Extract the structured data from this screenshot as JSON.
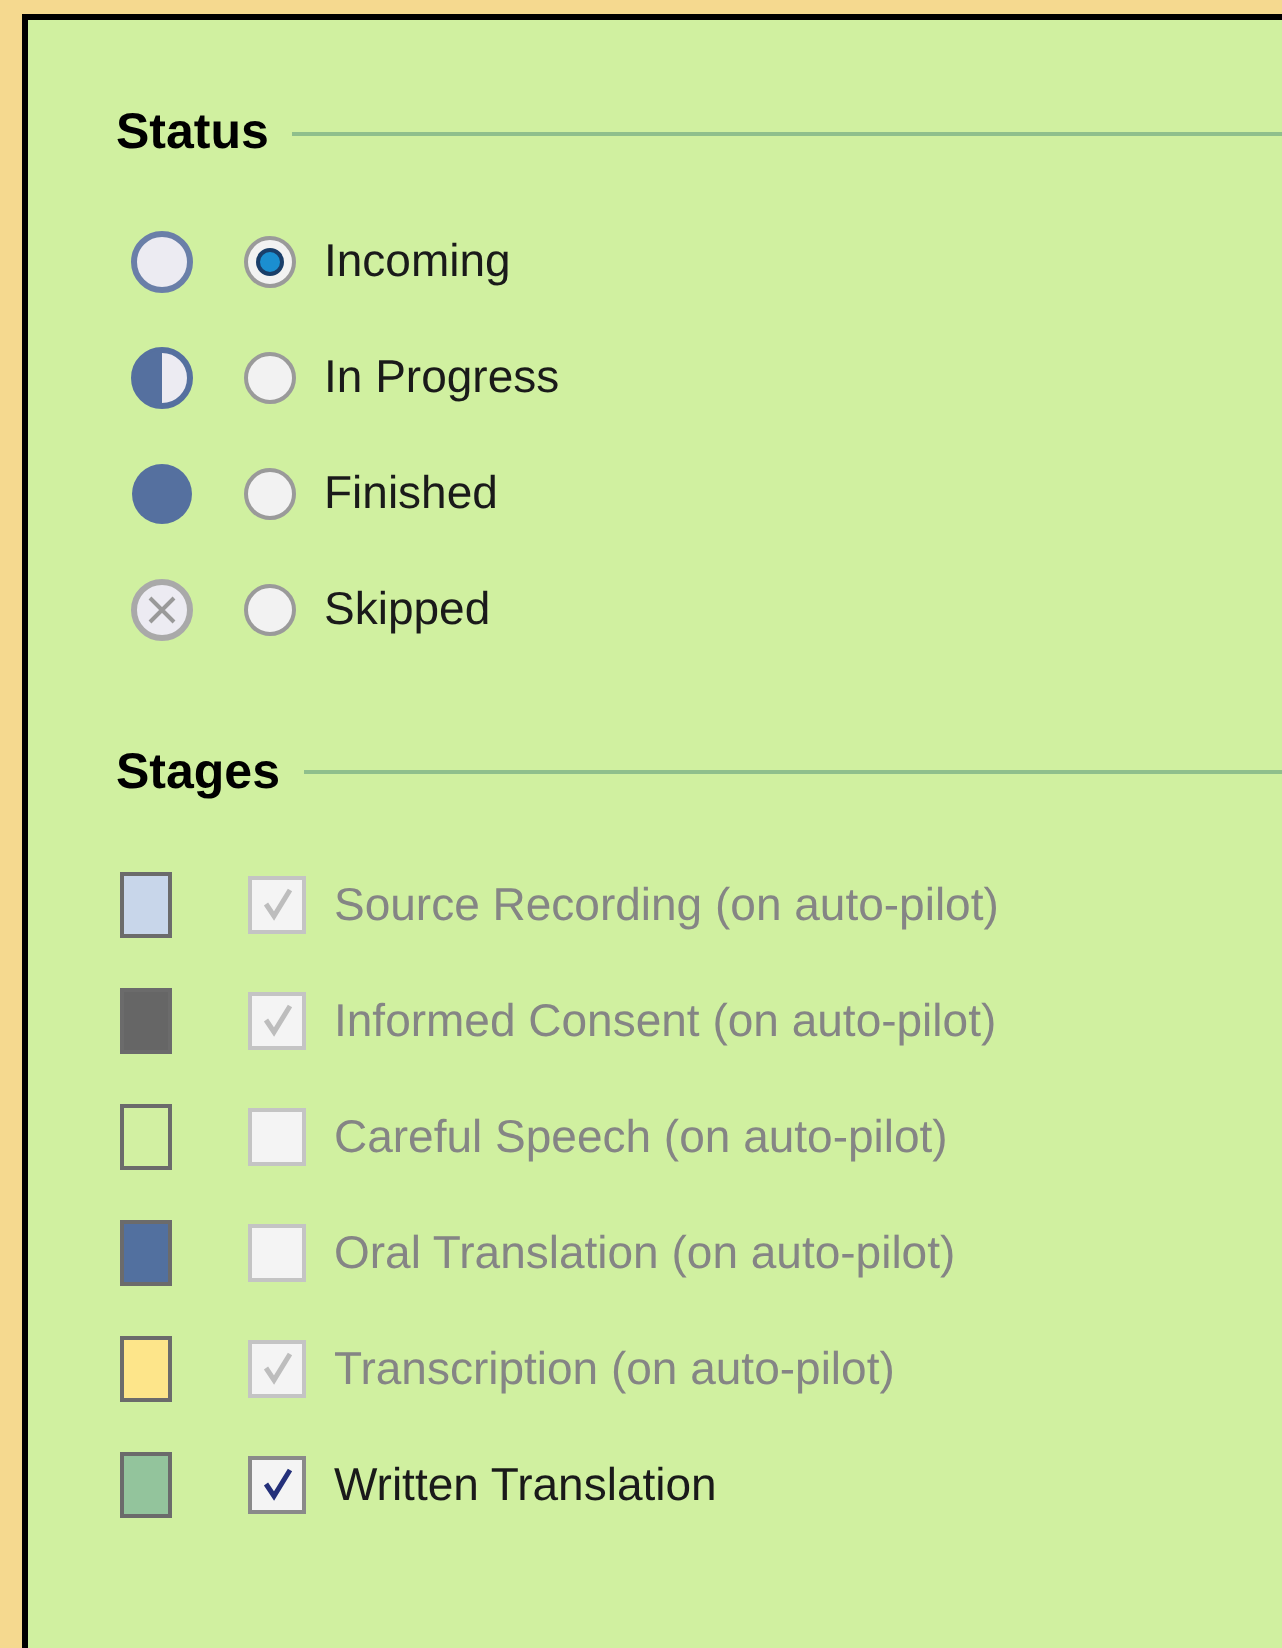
{
  "status": {
    "heading": "Status",
    "options": [
      {
        "kind": "incoming",
        "label": "Incoming",
        "selected": true
      },
      {
        "kind": "in_progress",
        "label": "In Progress",
        "selected": false
      },
      {
        "kind": "finished",
        "label": "Finished",
        "selected": false
      },
      {
        "kind": "skipped",
        "label": "Skipped",
        "selected": false
      }
    ]
  },
  "stages": {
    "heading": "Stages",
    "items": [
      {
        "color": "#c8d6ea",
        "checked": true,
        "disabled": true,
        "label": "Source Recording (on auto-pilot)"
      },
      {
        "color": "#666666",
        "checked": true,
        "disabled": true,
        "label": "Informed Consent (on auto-pilot)"
      },
      {
        "color": "#d2f0a2",
        "checked": false,
        "disabled": true,
        "label": "Careful Speech (on auto-pilot)"
      },
      {
        "color": "#52709f",
        "checked": false,
        "disabled": true,
        "label": "Oral Translation (on auto-pilot)"
      },
      {
        "color": "#fde58a",
        "checked": true,
        "disabled": true,
        "label": "Transcription (on auto-pilot)"
      },
      {
        "color": "#93c49c",
        "checked": true,
        "disabled": false,
        "label": "Written Translation"
      }
    ]
  }
}
